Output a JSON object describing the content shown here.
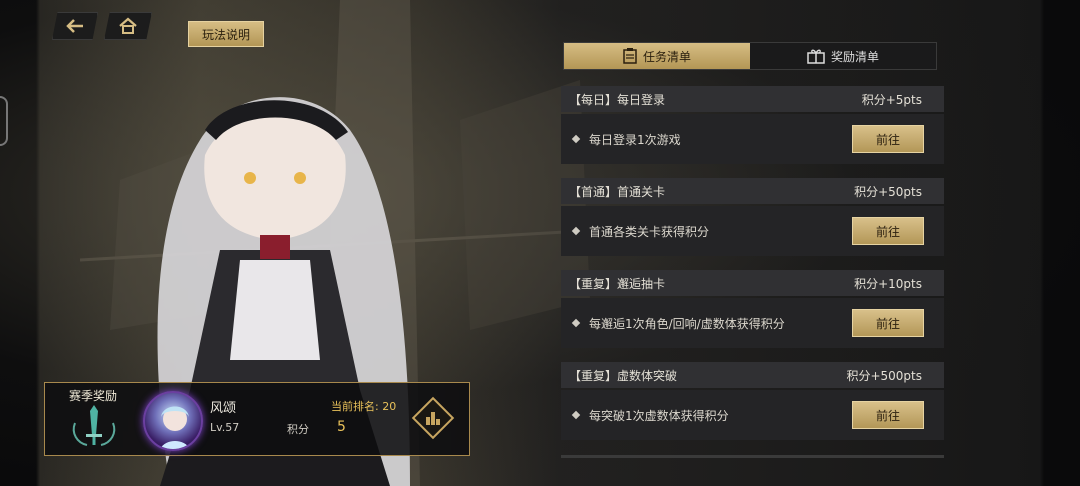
{
  "nav": {
    "back_icon": "back-arrow-icon",
    "home_icon": "home-icon",
    "help_label": "玩法说明"
  },
  "tabs": [
    {
      "label": "任务清单",
      "icon": "clipboard-icon",
      "active": true
    },
    {
      "label": "奖励清单",
      "icon": "gift-icon",
      "active": false
    }
  ],
  "tasks": [
    {
      "title": "【每日】每日登录",
      "points": "积分+5pts",
      "desc": "每日登录1次游戏",
      "button": "前往"
    },
    {
      "title": "【首通】首通关卡",
      "points": "积分+50pts",
      "desc": "首通各类关卡获得积分",
      "button": "前往"
    },
    {
      "title": "【重复】邂逅抽卡",
      "points": "积分+10pts",
      "desc": "每邂逅1次角色/回响/虚数体获得积分",
      "button": "前往"
    },
    {
      "title": "【重复】虚数体突破",
      "points": "积分+500pts",
      "desc": "每突破1次虚数体获得积分",
      "button": "前往"
    }
  ],
  "player": {
    "season_reward_label": "赛季奖励",
    "name": "风颂",
    "level": "Lv.57",
    "points_label": "积分",
    "points_value": "5",
    "rank_text": "当前排名: 20"
  },
  "colors": {
    "accent_gold": "#c7a560",
    "rank_gold": "#e8c15a",
    "panel_dark": "#242426"
  }
}
